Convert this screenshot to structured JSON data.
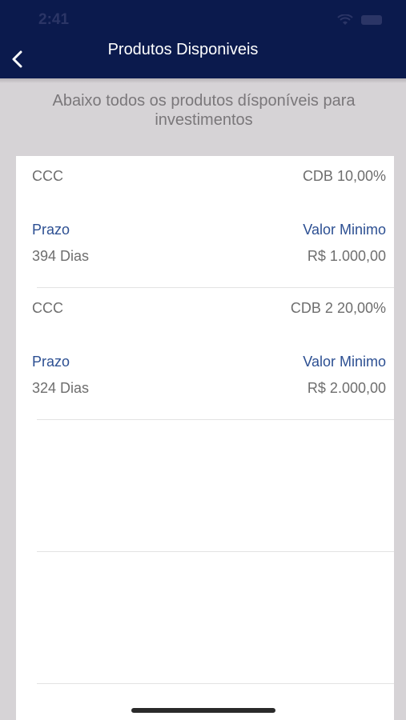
{
  "status_bar": {
    "time": "2:41"
  },
  "header": {
    "title": "Produtos Disponiveis",
    "back_icon": "chevron-left-icon"
  },
  "subtitle": "Abaixo todos os produtos dísponíveis para investimentos",
  "products": [
    {
      "name": "CCC",
      "product": "CDB 10,00%",
      "prazo_label": "Prazo",
      "prazo_value": "394 Dias",
      "valor_label": "Valor Minimo",
      "valor_value": "R$ 1.000,00"
    },
    {
      "name": "CCC",
      "product": "CDB 2 20,00%",
      "prazo_label": "Prazo",
      "prazo_value": "324 Dias",
      "valor_label": "Valor Minimo",
      "valor_value": "R$ 2.000,00"
    }
  ],
  "colors": {
    "header_bg": "#0b1a4d",
    "label_blue": "#2c4f92",
    "text_gray": "#6e6e6e",
    "page_bg": "#d6d3d6"
  }
}
